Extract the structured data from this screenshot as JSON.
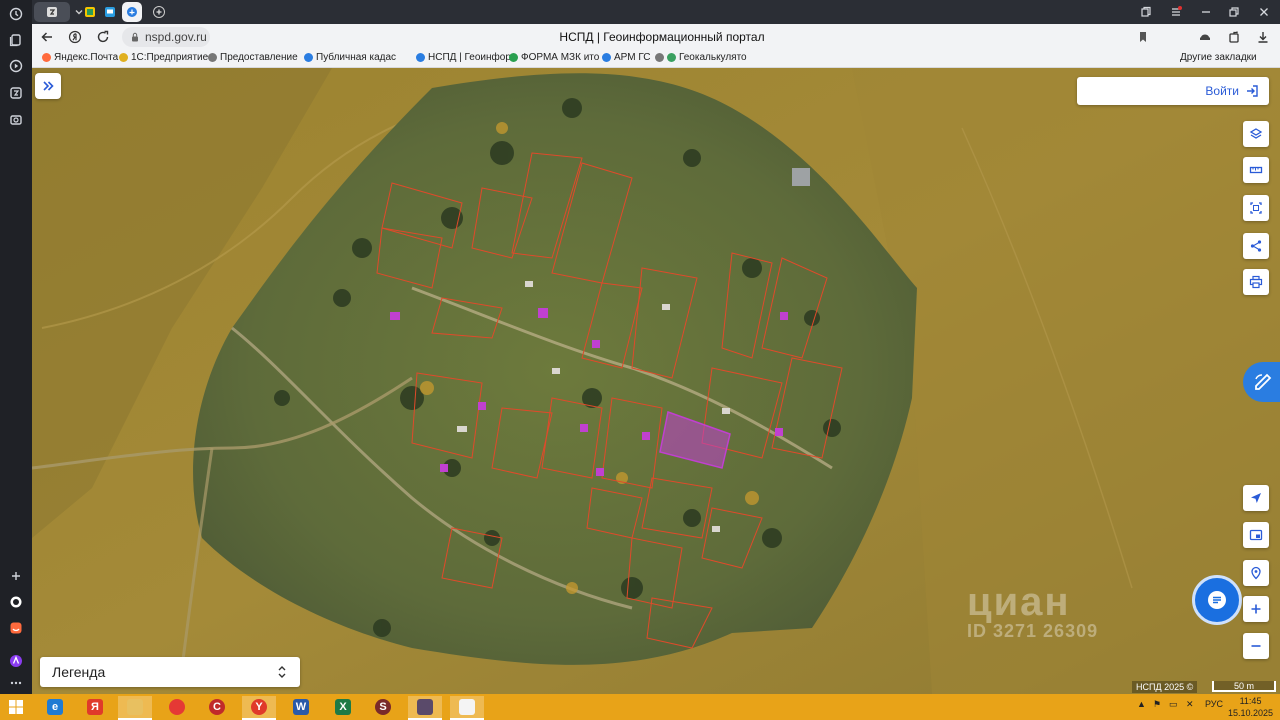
{
  "browser": {
    "url": "nspd.gov.ru",
    "page_title": "НСПД | Геоинформационный портал",
    "bookmarks": [
      "Яндекс.Почта",
      "1С:Предприятие",
      "Предоставление",
      "Публичная кадас",
      "НСПД | Геоинфор",
      "ФОРМА МЗК ито",
      "АРМ ГС",
      "Геокалькулято"
    ],
    "other_bookmarks": "Другие закладки"
  },
  "map": {
    "login_label": "Войти",
    "legend_label": "Легенда",
    "watermark": "циан",
    "watermark_id": "ID 3271 26309",
    "copyright": "НСПД 2025 ©",
    "scale_label": "50 m",
    "tools": [
      "layers-icon",
      "ruler-icon",
      "select-area-icon",
      "share-icon",
      "print-icon"
    ],
    "bottom_tools": [
      "locate-icon",
      "minimap-icon",
      "geo-search-icon",
      "zoom-in-icon",
      "zoom-out-icon"
    ]
  },
  "taskbar": {
    "language": "РУС",
    "time": "11:45",
    "date": "15.10.2025"
  },
  "colors": {
    "accent": "#2a5bd7",
    "parcel_outline": "#e04a2a",
    "highlight_parcel": "#c040d0",
    "taskbar": "#e8a318"
  }
}
